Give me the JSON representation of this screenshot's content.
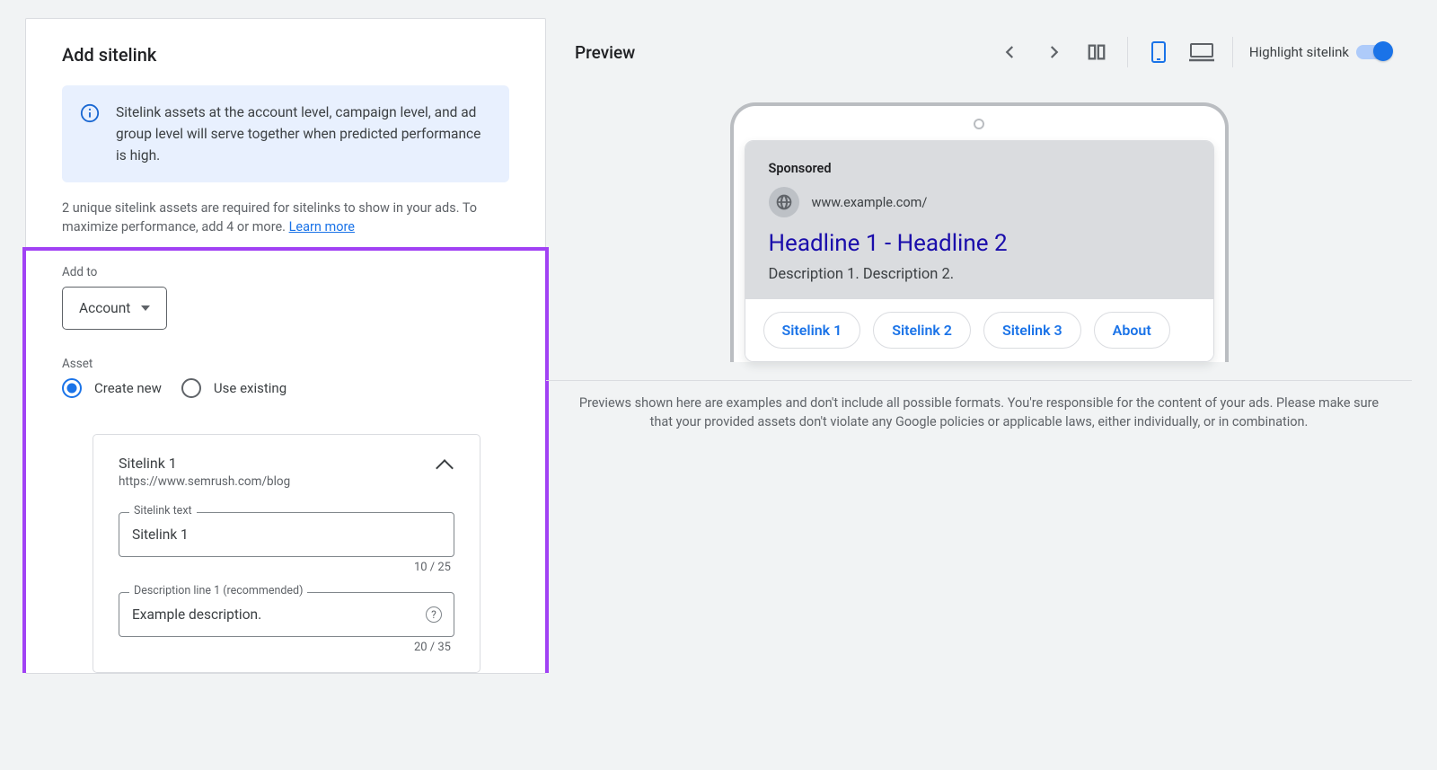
{
  "left": {
    "title": "Add sitelink",
    "info": "Sitelink assets at the account level, campaign level, and ad group level will serve together when predicted performance is high.",
    "requirement": "2 unique sitelink assets are required for sitelinks to show in your ads. To maximize performance, add 4 or more. ",
    "learnMore": "Learn more",
    "addToLabel": "Add to",
    "addToValue": "Account",
    "assetLabel": "Asset",
    "radioCreate": "Create new",
    "radioExisting": "Use existing",
    "card": {
      "title": "Sitelink 1",
      "url": "https://www.semrush.com/blog",
      "sitelinkTextLabel": "Sitelink text",
      "sitelinkTextValue": "Sitelink 1",
      "sitelinkTextCounter": "10 / 25",
      "desc1Label": "Description line 1 (recommended)",
      "desc1Value": "Example description.",
      "desc1Counter": "20 / 35"
    }
  },
  "right": {
    "title": "Preview",
    "highlightLabel": "Highlight sitelink",
    "ad": {
      "sponsored": "Sponsored",
      "url": "www.example.com/",
      "headline": "Headline 1 - Headline 2",
      "description": "Description 1. Description 2.",
      "sitelinks": [
        "Sitelink 1",
        "Sitelink 2",
        "Sitelink 3",
        "About"
      ]
    },
    "disclaimer": "Previews shown here are examples and don't include all possible formats. You're responsible for the content of your ads. Please make sure that your provided assets don't violate any Google policies or applicable laws, either individually, or in combination."
  }
}
